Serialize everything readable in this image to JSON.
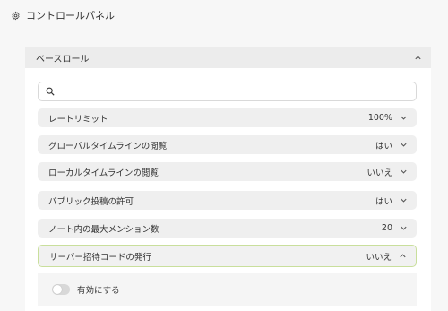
{
  "header": {
    "title": "コントロールパネル",
    "icon": "gear-icon"
  },
  "section": {
    "title": "ベースロール",
    "expanded": true
  },
  "search": {
    "value": "",
    "placeholder": ""
  },
  "settings": [
    {
      "label": "レートリミット",
      "value": "100%"
    },
    {
      "label": "グローバルタイムラインの閲覧",
      "value": "はい"
    },
    {
      "label": "ローカルタイムラインの閲覧",
      "value": "いいえ"
    },
    {
      "label": "パブリック投稿の許可",
      "value": "はい"
    },
    {
      "label": "ノート内の最大メンション数",
      "value": "20"
    },
    {
      "label": "サーバー招待コードの発行",
      "value": "いいえ",
      "expanded": true
    }
  ],
  "expanded_item": {
    "toggle_label": "有効にする",
    "toggle_on": false
  },
  "colors": {
    "active_border": "#c9df9c",
    "row_bg": "#efefef",
    "header_bg": "#ececec"
  }
}
